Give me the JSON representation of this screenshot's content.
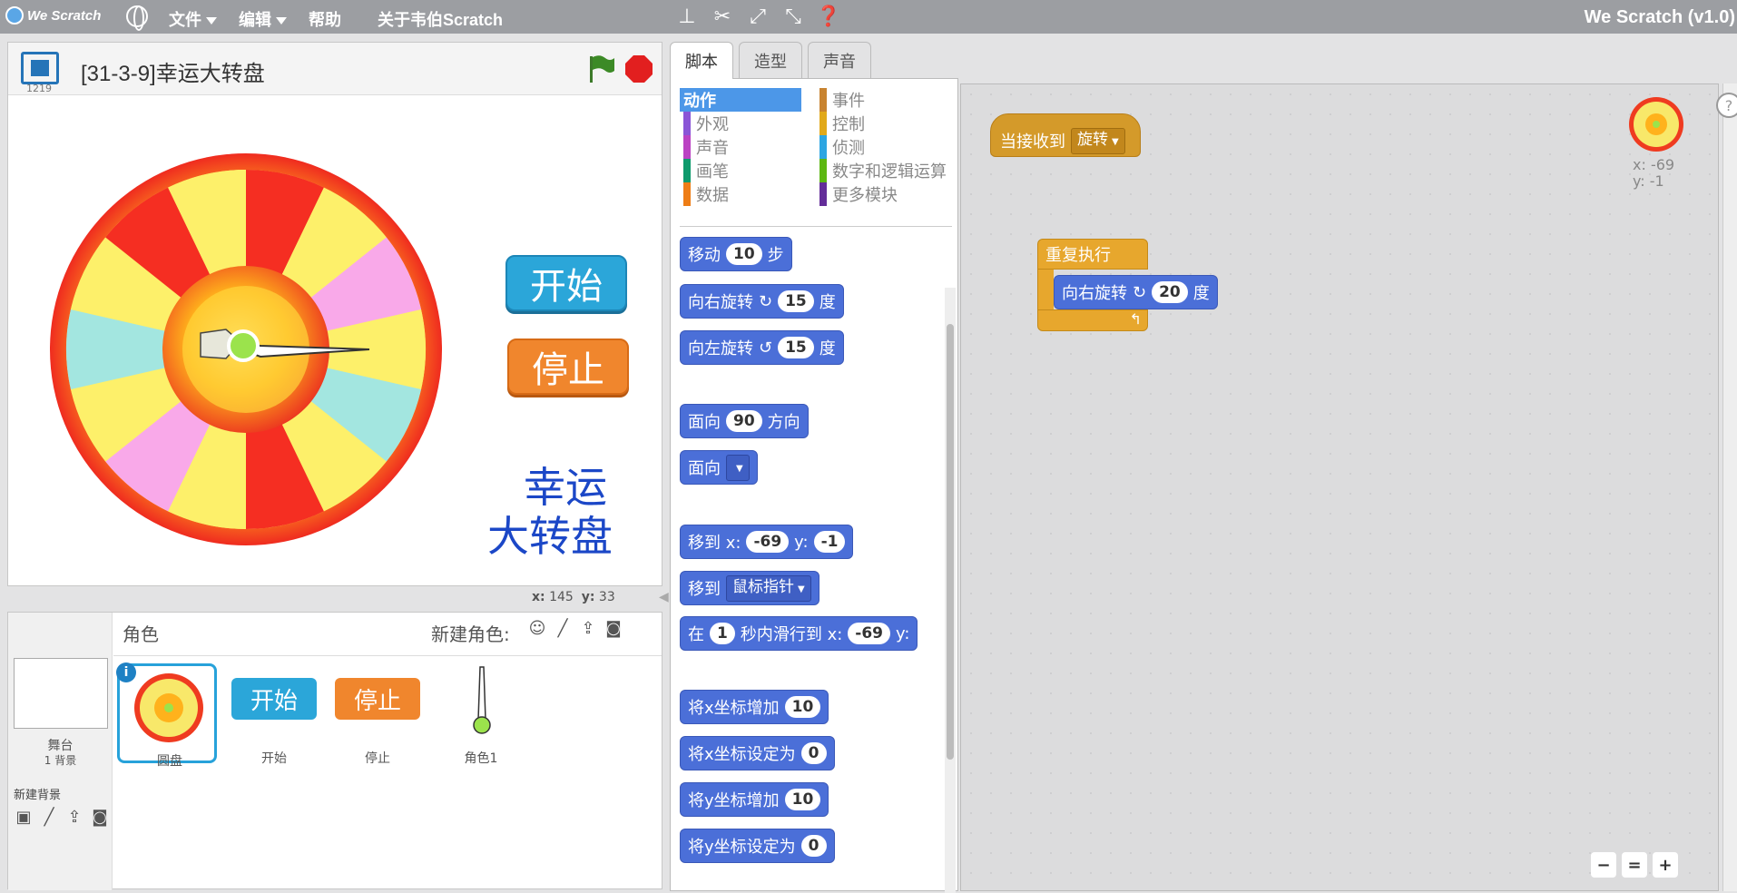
{
  "menubar": {
    "logo": "We Scratch",
    "menus": [
      "文件",
      "编辑",
      "帮助",
      "关于韦伯Scratch"
    ],
    "version": "We Scratch (v1.0)"
  },
  "stage": {
    "version_number": "1219",
    "project_title": "[31-3-9]幸运大转盘",
    "start_button": "开始",
    "stop_button": "停止",
    "title_line1": "幸运",
    "title_line2": "大转盘",
    "x_label": "x:",
    "x_value": "145",
    "y_label": "y:",
    "y_value": "33"
  },
  "sprites": {
    "header_title": "角色",
    "new_sprite_label": "新建角色:",
    "stage_label": "舞台",
    "stage_backdrops": "1 背景",
    "new_backdrop_label": "新建背景",
    "items": [
      {
        "name": "圆盘"
      },
      {
        "name": "开始"
      },
      {
        "name": "停止"
      },
      {
        "name": "角色1"
      }
    ]
  },
  "tabs": [
    "脚本",
    "造型",
    "声音"
  ],
  "categories": {
    "left": [
      {
        "label": "动作",
        "color": "#4c97e8"
      },
      {
        "label": "外观",
        "color": "#8a55d7"
      },
      {
        "label": "声音",
        "color": "#bb42c3"
      },
      {
        "label": "画笔",
        "color": "#0e9a6c"
      },
      {
        "label": "数据",
        "color": "#ee7d16"
      }
    ],
    "right": [
      {
        "label": "事件",
        "color": "#c88330"
      },
      {
        "label": "控制",
        "color": "#e1a91a"
      },
      {
        "label": "侦测",
        "color": "#2ca5e2"
      },
      {
        "label": "数字和逻辑运算",
        "color": "#5cb712"
      },
      {
        "label": "更多模块",
        "color": "#632d99"
      }
    ]
  },
  "palette": {
    "move": {
      "text": "移动",
      "value": "10",
      "unit": "步"
    },
    "turn_right": {
      "text": "向右旋转",
      "value": "15",
      "unit": "度"
    },
    "turn_left": {
      "text": "向左旋转",
      "value": "15",
      "unit": "度"
    },
    "point_dir": {
      "text": "面向",
      "value": "90",
      "unit": "方向"
    },
    "point_towards": {
      "text": "面向"
    },
    "goto_xy": {
      "text": "移到 x:",
      "x": "-69",
      "ylabel": "y:",
      "y": "-1"
    },
    "goto_target": {
      "text": "移到",
      "option": "鼠标指针"
    },
    "glide": {
      "text": "在",
      "secs": "1",
      "mid": "秒内滑行到 x:",
      "x": "-69",
      "ylabel": "y:"
    },
    "change_x": {
      "text": "将x坐标增加",
      "value": "10"
    },
    "set_x": {
      "text": "将x坐标设定为",
      "value": "0"
    },
    "change_y": {
      "text": "将y坐标增加",
      "value": "10"
    },
    "set_y": {
      "text": "将y坐标设定为",
      "value": "0"
    }
  },
  "script": {
    "hat_text": "当接收到",
    "hat_option": "旋转",
    "forever_text": "重复执行",
    "turn_text": "向右旋转",
    "turn_value": "20",
    "turn_unit": "度",
    "sprite_x": "x: -69",
    "sprite_y": "y: -1"
  },
  "colors": {
    "menubar": "#9c9ea2",
    "motion_block": "#4b6fd8",
    "event_block": "#d49a2a",
    "control_block": "#e7a72d"
  }
}
